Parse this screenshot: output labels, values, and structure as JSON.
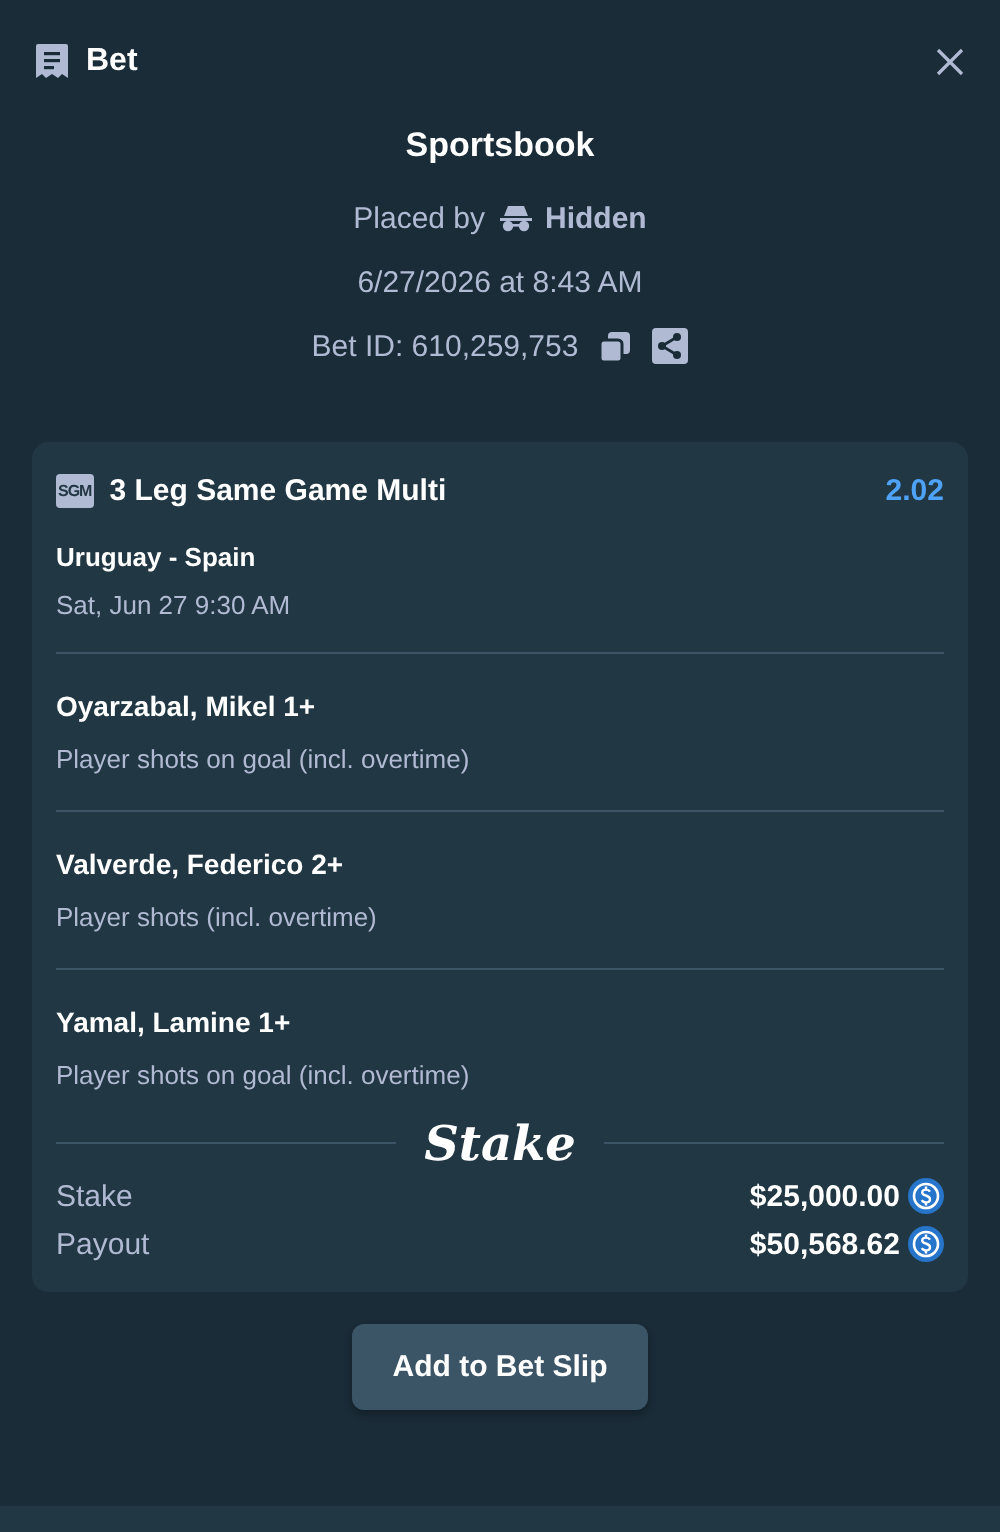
{
  "header": {
    "title": "Bet"
  },
  "summary": {
    "title": "Sportsbook",
    "placed_by_label": "Placed by",
    "placed_by_user": "Hidden",
    "datetime": "6/27/2026 at 8:43 AM",
    "bet_id": "Bet ID: 610,259,753"
  },
  "bet": {
    "badge": "SGM",
    "title": "3 Leg Same Game Multi",
    "odds": "2.02",
    "match": "Uruguay - Spain",
    "match_time": "Sat, Jun 27 9:30 AM",
    "legs": [
      {
        "selection": "Oyarzabal, Mikel 1+",
        "market": "Player shots on goal (incl. overtime)"
      },
      {
        "selection": "Valverde, Federico 2+",
        "market": "Player shots (incl. overtime)"
      },
      {
        "selection": "Yamal, Lamine 1+",
        "market": "Player shots on goal (incl. overtime)"
      }
    ],
    "logo": "Stake",
    "totals": [
      {
        "label": "Stake",
        "amount": "$25,000.00"
      },
      {
        "label": "Payout",
        "amount": "$50,568.62"
      }
    ]
  },
  "button": "Add to Bet Slip"
}
